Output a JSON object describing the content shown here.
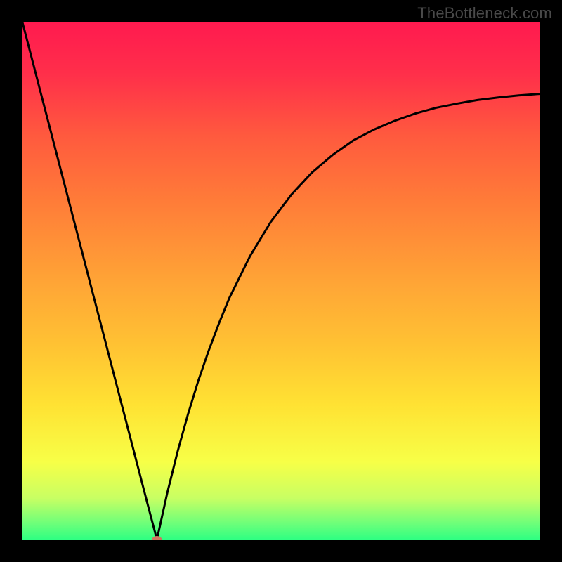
{
  "watermark": "TheBottleneck.com",
  "colors": {
    "frame": "#000000",
    "curve": "#000000",
    "marker_fill": "#cf755f",
    "gradient_stops": [
      {
        "offset": 0.0,
        "color": "#ff1a4f"
      },
      {
        "offset": 0.1,
        "color": "#ff2f4a"
      },
      {
        "offset": 0.22,
        "color": "#ff5a3e"
      },
      {
        "offset": 0.35,
        "color": "#ff7d38"
      },
      {
        "offset": 0.5,
        "color": "#ffa436"
      },
      {
        "offset": 0.62,
        "color": "#ffc133"
      },
      {
        "offset": 0.74,
        "color": "#ffe233"
      },
      {
        "offset": 0.85,
        "color": "#f7ff47"
      },
      {
        "offset": 0.92,
        "color": "#c8ff63"
      },
      {
        "offset": 0.97,
        "color": "#6bff7a"
      },
      {
        "offset": 1.0,
        "color": "#2fff82"
      }
    ]
  },
  "chart_data": {
    "type": "line",
    "title": "",
    "xlabel": "",
    "ylabel": "",
    "xlim": [
      0,
      1
    ],
    "ylim": [
      0,
      1
    ],
    "marker": {
      "x": 0.26,
      "y": 0.0
    },
    "series": [
      {
        "name": "curve",
        "x": [
          0.0,
          0.02,
          0.04,
          0.06,
          0.08,
          0.1,
          0.12,
          0.14,
          0.16,
          0.18,
          0.2,
          0.22,
          0.24,
          0.26,
          0.28,
          0.3,
          0.32,
          0.34,
          0.36,
          0.38,
          0.4,
          0.44,
          0.48,
          0.52,
          0.56,
          0.6,
          0.64,
          0.68,
          0.72,
          0.76,
          0.8,
          0.84,
          0.88,
          0.92,
          0.96,
          1.0
        ],
        "y": [
          1.0,
          0.923,
          0.846,
          0.769,
          0.692,
          0.615,
          0.538,
          0.461,
          0.384,
          0.307,
          0.23,
          0.153,
          0.076,
          0.0,
          0.09,
          0.17,
          0.242,
          0.307,
          0.365,
          0.418,
          0.467,
          0.548,
          0.614,
          0.667,
          0.71,
          0.744,
          0.772,
          0.793,
          0.81,
          0.824,
          0.835,
          0.843,
          0.85,
          0.855,
          0.859,
          0.862
        ]
      }
    ]
  }
}
